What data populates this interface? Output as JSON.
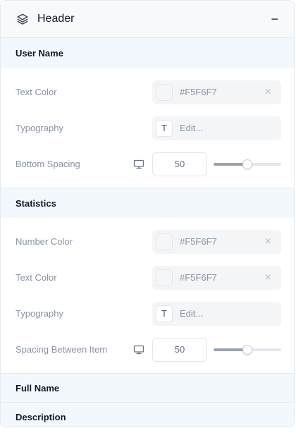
{
  "header": {
    "title": "Header",
    "collapse_symbol": "−",
    "icon": "layers-icon"
  },
  "sections": {
    "user_name": {
      "title": "User Name",
      "text_color": {
        "label": "Text Color",
        "value": "#F5F6F7",
        "clear_symbol": "×"
      },
      "typography": {
        "label": "Typography",
        "badge": "T",
        "edit_label": "Edit..."
      },
      "bottom_spacing": {
        "label": "Bottom Spacing",
        "value": "50",
        "slider_percent": 50
      }
    },
    "statistics": {
      "title": "Statistics",
      "number_color": {
        "label": "Number Color",
        "value": "#F5F6F7",
        "clear_symbol": "×"
      },
      "text_color": {
        "label": "Text Color",
        "value": "#F5F6F7",
        "clear_symbol": "×"
      },
      "typography": {
        "label": "Typography",
        "badge": "T",
        "edit_label": "Edit..."
      },
      "spacing_between_item": {
        "label": "Spacing Between Item",
        "value": "50",
        "slider_percent": 50
      }
    },
    "full_name": {
      "title": "Full Name"
    },
    "description": {
      "title": "Description"
    }
  },
  "icons": {
    "device": "monitor-icon"
  },
  "colors": {
    "swatch": "#F5F6F7",
    "section_bg": "#F3F8FD"
  }
}
